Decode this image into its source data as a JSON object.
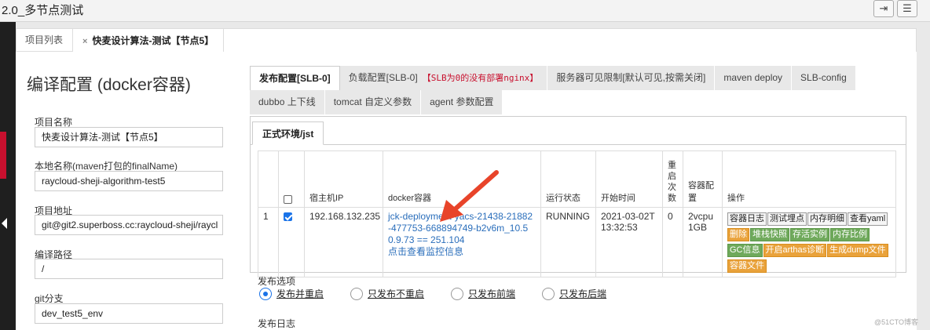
{
  "window": {
    "title": "2.0_多节点测试"
  },
  "top_tabs": [
    {
      "label": "项目列表"
    },
    {
      "label": "快麦设计算法-测试【节点5】",
      "close": "×"
    }
  ],
  "page_title": "编译配置 (docker容器)",
  "form": {
    "project_name_label": "项目名称",
    "project_name": "快麦设计算法-测试【节点5】",
    "local_name_label": "本地名称(maven打包的finalName)",
    "local_name": "raycloud-sheji-algorithm-test5",
    "project_url_label": "项目地址",
    "project_url": "git@git2.superboss.cc:raycloud-sheji/raycl",
    "build_path_label": "编译路径",
    "build_path": "/",
    "git_branch_label": "git分支",
    "git_branch": "dev_test5_env"
  },
  "config_tabs_row1": [
    {
      "label": "发布配置[SLB-0]"
    },
    {
      "label": "负载配置[SLB-0]",
      "warn": "【SLB为0的没有部署nginx】"
    },
    {
      "label": "服务器可见限制[默认可见,按需关闭]"
    },
    {
      "label": "maven deploy"
    },
    {
      "label": "SLB-config"
    }
  ],
  "config_tabs_row2": [
    {
      "label": "dubbo 上下线"
    },
    {
      "label": "tomcat 自定义参数"
    },
    {
      "label": "agent 参数配置"
    }
  ],
  "env_tab": "正式环境/jst",
  "table": {
    "headers": {
      "host_ip": "宿主机IP",
      "docker": "docker容器",
      "status": "运行状态",
      "start_time": "开始时间",
      "restarts": "重启次数",
      "spec": "容器配置",
      "ops": "操作"
    },
    "rows": [
      {
        "index": "1",
        "checked": true,
        "host_ip": "192.168.132.235",
        "docker_name": "jck-deployment-yacs-21438-21882-477753-668894749-b2v6m_10.50.9.73 == 251.104",
        "monitor_link": "点击查看监控信息",
        "status": "RUNNING",
        "start_time": "2021-03-02T13:32:53",
        "restarts": "0",
        "spec": "2vcpu 1GB",
        "ops": [
          {
            "label": "容器日志",
            "style": "plain"
          },
          {
            "label": "测试埋点",
            "style": "plain"
          },
          {
            "label": "内存明细",
            "style": "plain"
          },
          {
            "label": "查看yaml",
            "style": "plain"
          },
          {
            "label": "删除",
            "style": "orange"
          },
          {
            "label": "堆栈快照",
            "style": "green"
          },
          {
            "label": "存活实例",
            "style": "green"
          },
          {
            "label": "内存比例",
            "style": "green"
          },
          {
            "label": "GC信息",
            "style": "green"
          },
          {
            "label": "开启arthas诊断",
            "style": "orange"
          },
          {
            "label": "生成dump文件",
            "style": "orange"
          },
          {
            "label": "容器文件",
            "style": "orange"
          }
        ]
      }
    ]
  },
  "publish_options": {
    "label": "发布选项",
    "options": [
      {
        "label": "发布并重启",
        "selected": true
      },
      {
        "label": "只发布不重启",
        "selected": false
      },
      {
        "label": "只发布前端",
        "selected": false
      },
      {
        "label": "只发布后端",
        "selected": false
      }
    ]
  },
  "publish_log_label": "发布日志",
  "watermark": "@51CTO博客",
  "colors": {
    "link": "#2a6ebb",
    "orange": "#e9a23b",
    "green": "#6fa95b",
    "annotation": "#e8442a"
  },
  "icons": {
    "window_btn1": "logout-icon",
    "window_btn2": "menu-icon",
    "annotation": "red-arrow-icon"
  }
}
